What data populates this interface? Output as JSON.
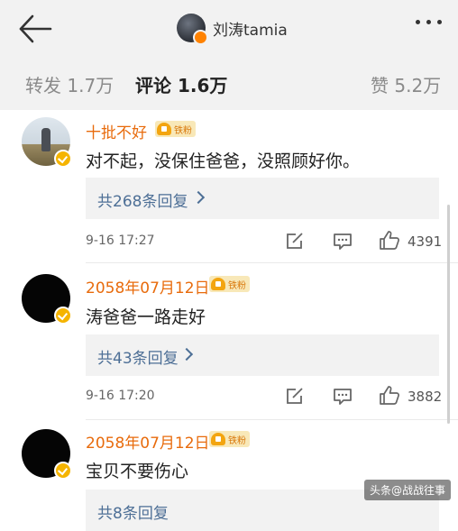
{
  "header": {
    "username": "刘涛tamia"
  },
  "tabs": [
    {
      "label": "转发 1.7万"
    },
    {
      "label": "评论 1.6万"
    },
    {
      "label": "赞 5.2万"
    }
  ],
  "comments": [
    {
      "username": "十批不好",
      "fan_badge": "铁粉",
      "text": "对不起，没保住爸爸，没照顾好你。",
      "replies": "共268条回复",
      "time": "9-16 17:27",
      "likes": "4391"
    },
    {
      "username": "2058年07月12日",
      "fan_badge": "铁粉",
      "text": "涛爸爸一路走好",
      "replies": "共43条回复",
      "time": "9-16 17:20",
      "likes": "3882"
    },
    {
      "username": "2058年07月12日",
      "fan_badge": "铁粉",
      "text": "宝贝不要伤心",
      "replies": "共8条回复",
      "time": "",
      "likes": ""
    }
  ],
  "watermark": "头条@战战往事",
  "colors": {
    "username": "#e86b0c",
    "link": "#4d6f96",
    "background_header": "#f2f2f2"
  }
}
